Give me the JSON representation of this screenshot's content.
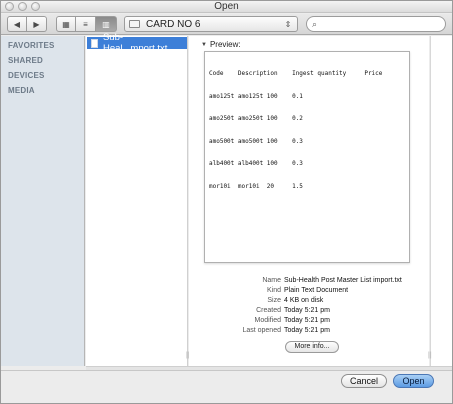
{
  "window": {
    "title": "Open"
  },
  "toolbar": {
    "back_icon": "back-arrow-icon",
    "forward_icon": "forward-arrow-icon",
    "icon_view_icon": "icon-view-icon",
    "list_view_icon": "list-view-icon",
    "column_view_icon": "column-view-icon",
    "location": "CARD NO 6",
    "search_placeholder": ""
  },
  "sidebar": {
    "sections": [
      {
        "label": "FAVORITES"
      },
      {
        "label": "SHARED"
      },
      {
        "label": "DEVICES"
      },
      {
        "label": "MEDIA"
      }
    ]
  },
  "browser": {
    "selected_file": "Sub-Heal...mport.txt"
  },
  "preview": {
    "label": "Preview:",
    "file_lines": [
      "Code    Description    Ingest quantity     Price",
      "amo125t amo125t 100    0.1",
      "amo250t amo250t 100    0.2",
      "amo500t amo500t 100    0.3",
      "alb400t alb400t 100    0.3",
      "mor10i  mor10i  20     1.5"
    ]
  },
  "info": {
    "rows": [
      {
        "key": "Name",
        "value": "Sub-Health Post Master List import.txt"
      },
      {
        "key": "Kind",
        "value": "Plain Text Document"
      },
      {
        "key": "Size",
        "value": "4 KB on disk"
      },
      {
        "key": "Created",
        "value": "Today 5:21 pm"
      },
      {
        "key": "Modified",
        "value": "Today 5:21 pm"
      },
      {
        "key": "Last opened",
        "value": "Today 5:21 pm"
      }
    ],
    "more_button": "More info..."
  },
  "buttons": {
    "cancel": "Cancel",
    "open": "Open"
  },
  "colors": {
    "selection": "#3d7fd8",
    "sidebar_bg": "#dde4eb",
    "default_button": "#5c9be3"
  }
}
